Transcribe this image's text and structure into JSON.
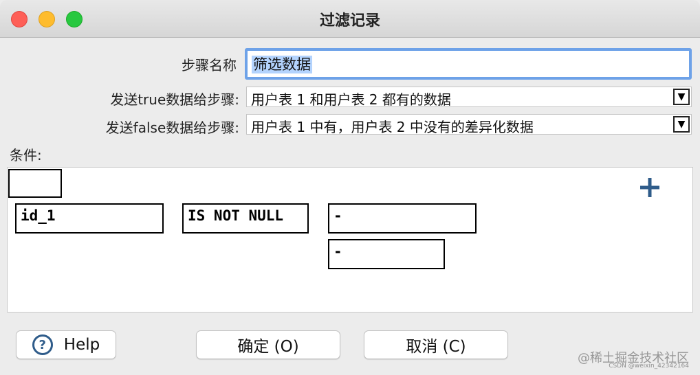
{
  "window": {
    "title": "过滤记录"
  },
  "form": {
    "step_name_label": "步骤名称",
    "step_name_value": "筛选数据",
    "true_target_label": "发送true数据给步骤:",
    "true_target_value": "用户表 1 和用户表 2 都有的数据",
    "false_target_label": "发送false数据给步骤:",
    "false_target_value": "用户表 1 中有，用户表 2 中没有的差异化数据"
  },
  "conditions": {
    "label": "条件:",
    "negate_box": "",
    "field": "id_1",
    "function": "IS NOT NULL",
    "value1": "-",
    "value2": "-"
  },
  "buttons": {
    "help": "Help",
    "ok": "确定 (O)",
    "cancel": "取消 (C)"
  },
  "watermark": {
    "main": "@稀土掘金技术社区",
    "sub": "CSDN @weixin_42342164"
  },
  "icons": {
    "help": "question-circle-icon",
    "add": "plus-icon",
    "dropdown": "triangle-down-icon"
  },
  "colors": {
    "focus_ring": "#6ea2e8",
    "selection": "#b3d3fd",
    "plus": "#2f5c8a"
  }
}
